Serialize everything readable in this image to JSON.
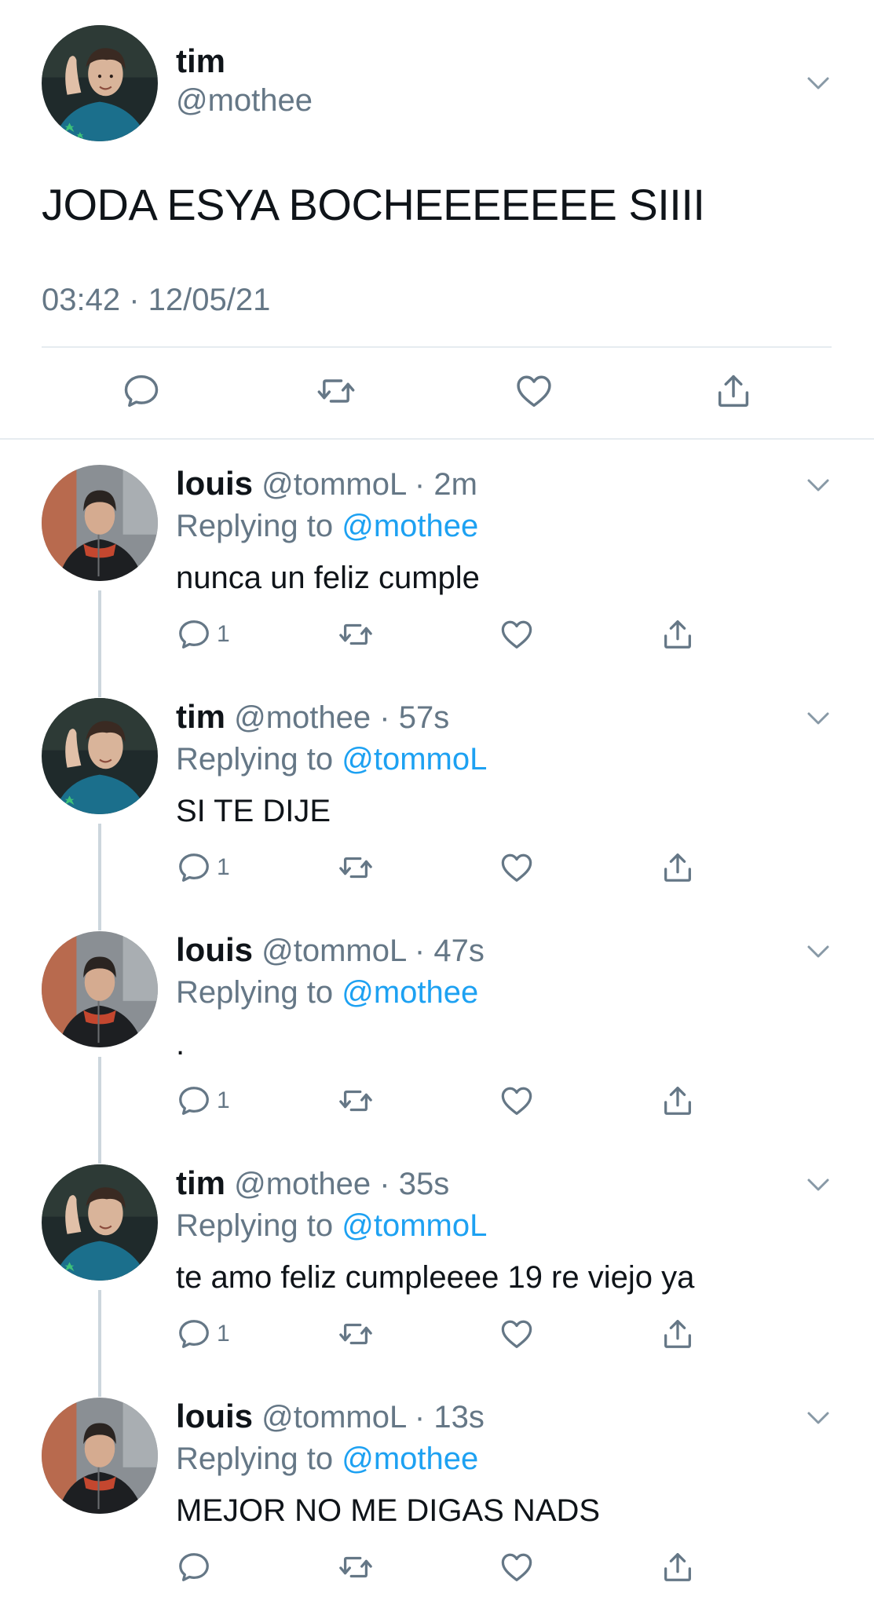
{
  "main_tweet": {
    "name": "tim",
    "handle": "@mothee",
    "text": "JODA ESYA BOCHEEEEEEE SIIII",
    "timestamp": "03:42 · 12/05/21",
    "actions": {
      "reply_icon": "reply-icon",
      "retweet_icon": "retweet-icon",
      "like_icon": "like-icon",
      "share_icon": "share-icon"
    }
  },
  "replies": [
    {
      "name": "louis",
      "handle": "@tommoL",
      "time": "· 2m",
      "replying_prefix": "Replying to",
      "replying_to": "@mothee",
      "text": "nunca un feliz cumple",
      "reply_count": "1",
      "avatar": "louis"
    },
    {
      "name": "tim",
      "handle": "@mothee",
      "time": "· 57s",
      "replying_prefix": "Replying to",
      "replying_to": "@tommoL",
      "text": "SI TE DIJE",
      "reply_count": "1",
      "avatar": "tim"
    },
    {
      "name": "louis",
      "handle": "@tommoL",
      "time": "· 47s",
      "replying_prefix": "Replying to",
      "replying_to": "@mothee",
      "text": ".",
      "reply_count": "1",
      "avatar": "louis"
    },
    {
      "name": "tim",
      "handle": "@mothee",
      "time": "· 35s",
      "replying_prefix": "Replying to",
      "replying_to": "@tommoL",
      "text": "te amo feliz cumpleeee 19 re viejo ya",
      "reply_count": "1",
      "avatar": "tim"
    },
    {
      "name": "louis",
      "handle": "@tommoL",
      "time": "· 13s",
      "replying_prefix": "Replying to",
      "replying_to": "@mothee",
      "text": "MEJOR NO ME DIGAS NADS",
      "reply_count": "",
      "avatar": "louis"
    }
  ],
  "colors": {
    "text_primary": "#0f1419",
    "text_secondary": "#657786",
    "link": "#1da1f2",
    "divider": "#e6ecf0",
    "thread_line": "#ccd6dd"
  }
}
